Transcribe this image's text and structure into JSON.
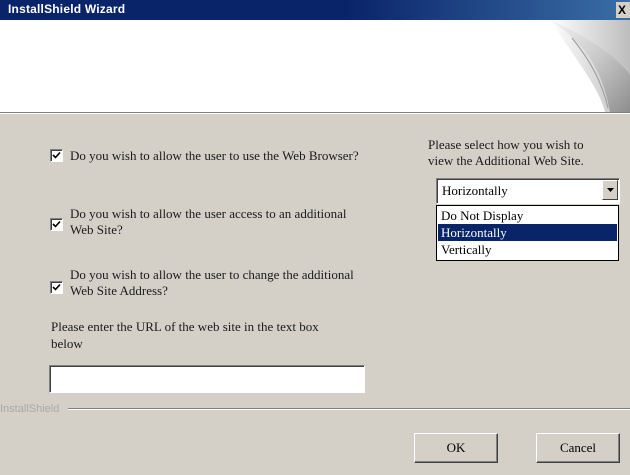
{
  "window": {
    "title": "InstallShield Wizard",
    "close_glyph": "X"
  },
  "options": {
    "q1": {
      "label": "Do you wish to allow the user to use the Web Browser?",
      "checked": true
    },
    "q2": {
      "label_line1": "Do you wish to allow the user access to an additional",
      "label_line2": "Web Site?",
      "checked": true
    },
    "q3": {
      "label_line1": "Do you wish to allow the user to change the additional",
      "label_line2": "Web Site Address?",
      "checked": true
    }
  },
  "url": {
    "prompt_line1": "Please enter the URL of the web site in the text box",
    "prompt_line2": "below",
    "value": ""
  },
  "display": {
    "prompt_line1": "Please select how you wish to",
    "prompt_line2": "view the Additional Web Site.",
    "selected": "Horizontally",
    "options": [
      "Do Not Display",
      "Horizontally",
      "Vertically"
    ],
    "highlighted": "Horizontally"
  },
  "footer": {
    "brand": "InstallShield",
    "ok_label": "OK",
    "cancel_label": "Cancel"
  },
  "colors": {
    "titlebar": "#0a246a",
    "dialog_bg": "#d4d0c8",
    "selection": "#0a246a"
  }
}
